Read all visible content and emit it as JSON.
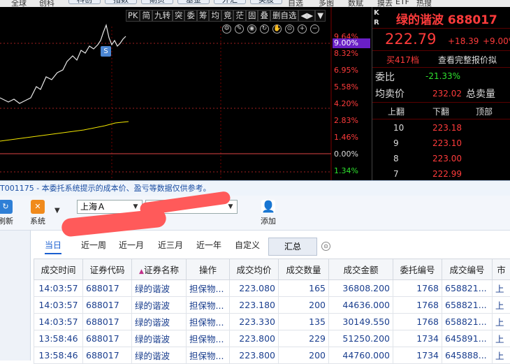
{
  "menubar": {
    "items": [
      "全球",
      "创科",
      "科创",
      "指数",
      "期货",
      "基金",
      "外汇",
      "美股",
      "自选",
      "多图",
      "数赋",
      "摸去",
      "ETF",
      "热搜"
    ]
  },
  "chart": {
    "tools": [
      "PK",
      "简",
      "九转",
      "突",
      "委",
      "筹",
      "均",
      "竞",
      "茫",
      "固",
      "叠",
      "删自选",
      "◀▶",
      "▼"
    ],
    "pct_labels": [
      "9.64%",
      "9.00%",
      "8.32%",
      "6.95%",
      "5.58%",
      "4.20%",
      "2.83%",
      "1.46%",
      "0.00%",
      "1.34%"
    ],
    "marker": "S"
  },
  "quote": {
    "kr": "K\nR",
    "name": "绿的谐波 688017",
    "price": "222.79",
    "change": "+18.39",
    "pct": "+9.00%",
    "buy_levels": "买417档",
    "full_quote_btn": "查看完整报价拟",
    "weibi_label": "委比",
    "weibi_value": "-21.33%",
    "avg_label": "均卖价",
    "avg_value": "232.02",
    "total_sell": "总卖量",
    "hdr": [
      "上翻",
      "下翻",
      "顶部"
    ],
    "levels": [
      {
        "n": "10",
        "p": "223.18"
      },
      {
        "n": "9",
        "p": "223.10"
      },
      {
        "n": "8",
        "p": "223.00"
      },
      {
        "n": "7",
        "p": "222.99"
      }
    ]
  },
  "notice": "T001175 - 本委托系统提示的成本价、盈亏等数据仅供参考。",
  "toolbar": {
    "refresh": "刷新",
    "system": "系统",
    "market": "上海Ａ",
    "add": "添加"
  },
  "tabs": [
    "当日",
    "近一周",
    "近一月",
    "近三月",
    "近一年",
    "自定义"
  ],
  "summary_btn": "汇总",
  "table": {
    "headers": [
      "成交时间",
      "证券代码",
      "证券名称",
      "操作",
      "成交均价",
      "成交数量",
      "成交金额",
      "委托编号",
      "成交编号",
      "市"
    ],
    "rows": [
      [
        "14:03:57",
        "688017",
        "绿的谐波",
        "担保物...",
        "223.080",
        "165",
        "36808.200",
        "1768",
        "658821...",
        "上"
      ],
      [
        "14:03:57",
        "688017",
        "绿的谐波",
        "担保物...",
        "223.180",
        "200",
        "44636.000",
        "1768",
        "658821...",
        "上"
      ],
      [
        "14:03:57",
        "688017",
        "绿的谐波",
        "担保物...",
        "223.330",
        "135",
        "30149.550",
        "1768",
        "658821...",
        "上"
      ],
      [
        "13:58:46",
        "688017",
        "绿的谐波",
        "担保物...",
        "223.800",
        "229",
        "51250.200",
        "1734",
        "645891...",
        "上"
      ],
      [
        "13:58:46",
        "688017",
        "绿的谐波",
        "担保物...",
        "223.800",
        "200",
        "44760.000",
        "1734",
        "645888...",
        "上"
      ]
    ]
  },
  "colors": {
    "up": "#ff3b3b",
    "down": "#2ee32e",
    "link": "#1b3f8f",
    "accent": "#1a5fd0",
    "purple_tag": "#6a1fc6"
  }
}
